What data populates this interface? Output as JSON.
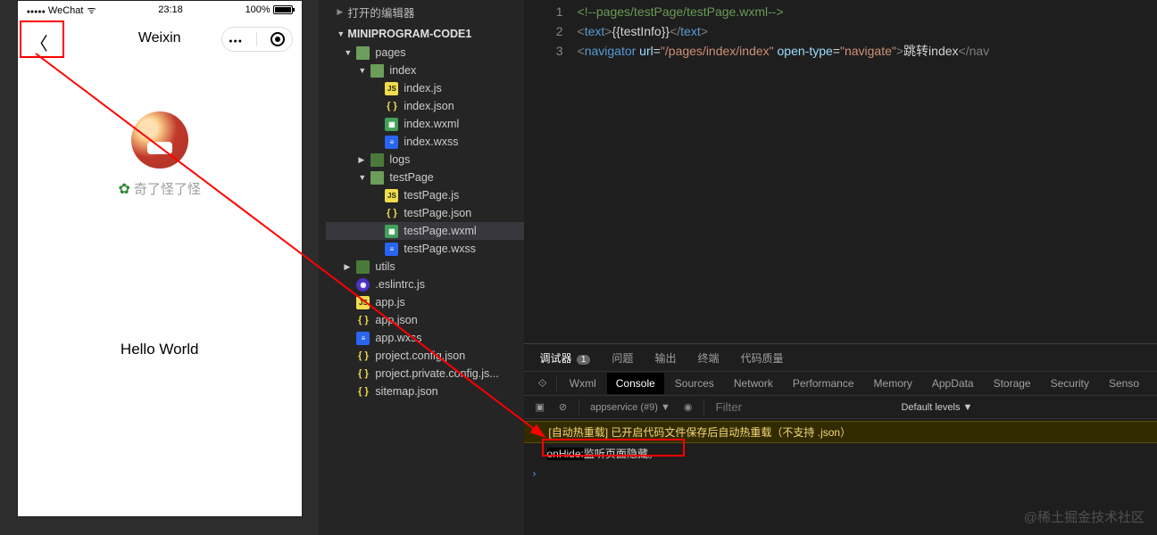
{
  "simulator": {
    "carrier": "WeChat",
    "time": "23:18",
    "battery_pct": "100%",
    "nav_title": "Weixin",
    "username": "奇了怪了怪",
    "hello_text": "Hello World"
  },
  "explorer": {
    "section_open_editors": "打开的编辑器",
    "project_name": "MINIPROGRAM-CODE1",
    "tree": {
      "pages": "pages",
      "index": "index",
      "index_js": "index.js",
      "index_json": "index.json",
      "index_wxml": "index.wxml",
      "index_wxss": "index.wxss",
      "logs": "logs",
      "testPage": "testPage",
      "testPage_js": "testPage.js",
      "testPage_json": "testPage.json",
      "testPage_wxml": "testPage.wxml",
      "testPage_wxss": "testPage.wxss",
      "utils": "utils",
      "eslintrc": ".eslintrc.js",
      "app_js": "app.js",
      "app_json": "app.json",
      "app_wxss": "app.wxss",
      "project_config": "project.config.json",
      "project_private": "project.private.config.js...",
      "sitemap": "sitemap.json"
    }
  },
  "code": {
    "line1": "<!--pages/testPage/testPage.wxml-->",
    "line2_tag_open": "<",
    "line2_text": "text",
    "line2_content": "{{testInfo}}",
    "line3_nav": "navigator",
    "line3_url_attr": "url",
    "line3_url_val": "\"/pages/index/index\"",
    "line3_ot_attr": "open-type",
    "line3_ot_val": "\"navigate\"",
    "line3_body": "跳转index",
    "line3_close_partial": "</nav"
  },
  "debug": {
    "tabs": {
      "debugger": "调试器",
      "count": "1",
      "problems": "问题",
      "output": "输出",
      "terminal": "终端",
      "quality": "代码质量"
    },
    "devtabs": {
      "wxml": "Wxml",
      "console": "Console",
      "sources": "Sources",
      "network": "Network",
      "performance": "Performance",
      "memory": "Memory",
      "appdata": "AppData",
      "storage": "Storage",
      "security": "Security",
      "sensor": "Senso"
    },
    "consolebar": {
      "context": "appservice (#9)",
      "filter_ph": "Filter",
      "levels": "Default levels ▼"
    },
    "logs": {
      "warn": "[自动热重载] 已开启代码文件保存后自动热重载（不支持 .json）",
      "info_prefix": "onHide:",
      "info_body": "监听页面隐藏。"
    }
  },
  "watermark": "@稀土掘金技术社区"
}
